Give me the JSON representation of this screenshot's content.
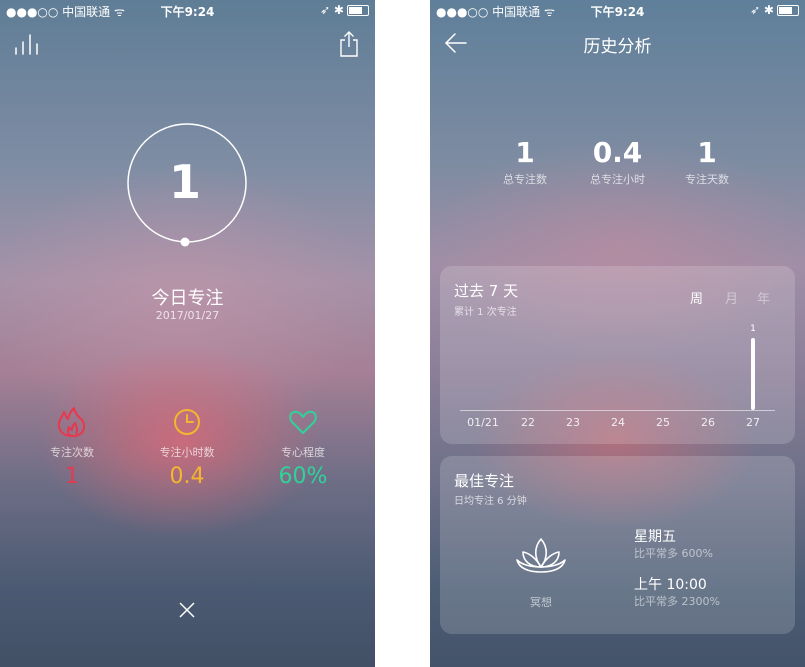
{
  "status": {
    "carrier": "●●●○○ 中国联通 ᯤ",
    "time": "下午9:24",
    "right": "➶ ✱"
  },
  "left": {
    "focus_count": "1",
    "title": "今日专注",
    "date": "2017/01/27",
    "stats": [
      {
        "label": "专注次数",
        "value": "1",
        "color": "#e8384f",
        "icon": "flame-icon"
      },
      {
        "label": "专注小时数",
        "value": "0.4",
        "color": "#f5b52e",
        "icon": "clock-icon"
      },
      {
        "label": "专心程度",
        "value": "60%",
        "color": "#2fd39a",
        "icon": "heart-icon"
      }
    ]
  },
  "right": {
    "title": "历史分析",
    "summary": [
      {
        "value": "1",
        "label": "总专注数"
      },
      {
        "value": "0.4",
        "label": "总专注小时"
      },
      {
        "value": "1",
        "label": "专注天数"
      }
    ],
    "past_card": {
      "title": "过去 7 天",
      "subtitle": "累计 1 次专注",
      "tabs": [
        "周",
        "月",
        "年"
      ],
      "active_tab": "周"
    },
    "best_card": {
      "title": "最佳专注",
      "subtitle": "日均专注 6 分钟",
      "icon_label": "冥想",
      "day": "星期五",
      "day_note": "比平常多 600%",
      "time": "上午 10:00",
      "time_note": "比平常多 2300%"
    }
  },
  "chart_data": {
    "type": "bar",
    "categories": [
      "01/21",
      "22",
      "23",
      "24",
      "25",
      "26",
      "27"
    ],
    "values": [
      0,
      0,
      0,
      0,
      0,
      0,
      1
    ],
    "data_labels": [
      "",
      "",
      "",
      "",
      "",
      "",
      "1"
    ]
  }
}
